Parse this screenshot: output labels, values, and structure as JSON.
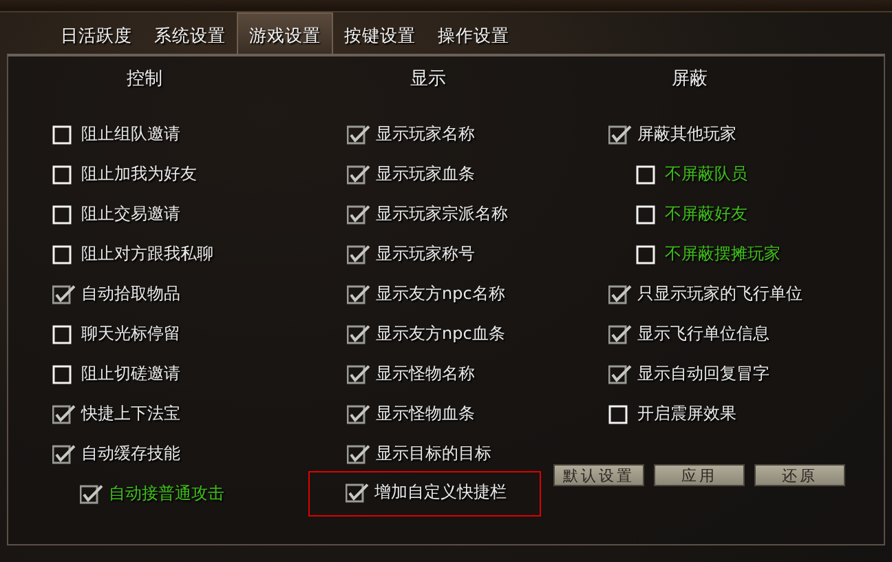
{
  "tabs": [
    {
      "label": "日活跃度",
      "selected": false
    },
    {
      "label": "系统设置",
      "selected": false
    },
    {
      "label": "游戏设置",
      "selected": true
    },
    {
      "label": "按键设置",
      "selected": false
    },
    {
      "label": "操作设置",
      "selected": false
    }
  ],
  "columns": [
    {
      "heading": "控制",
      "options": [
        {
          "label": "阻止组队邀请",
          "checked": false,
          "highlighted": false,
          "outlined": false
        },
        {
          "label": "阻止加我为好友",
          "checked": false,
          "highlighted": false,
          "outlined": false
        },
        {
          "label": "阻止交易邀请",
          "checked": false,
          "highlighted": false,
          "outlined": false
        },
        {
          "label": "阻止对方跟我私聊",
          "checked": false,
          "highlighted": false,
          "outlined": false
        },
        {
          "label": "自动拾取物品",
          "checked": true,
          "highlighted": false,
          "outlined": false
        },
        {
          "label": "聊天光标停留",
          "checked": false,
          "highlighted": false,
          "outlined": false
        },
        {
          "label": "阻止切磋邀请",
          "checked": false,
          "highlighted": false,
          "outlined": false
        },
        {
          "label": "快捷上下法宝",
          "checked": true,
          "highlighted": false,
          "outlined": false
        },
        {
          "label": "自动缓存技能",
          "checked": true,
          "highlighted": false,
          "outlined": false,
          "children": [
            {
              "label": "自动接普通攻击",
              "checked": true,
              "highlighted": true,
              "outlined": false
            }
          ]
        }
      ]
    },
    {
      "heading": "显示",
      "options": [
        {
          "label": "显示玩家名称",
          "checked": true,
          "highlighted": false,
          "outlined": false
        },
        {
          "label": "显示玩家血条",
          "checked": true,
          "highlighted": false,
          "outlined": false
        },
        {
          "label": "显示玩家宗派名称",
          "checked": true,
          "highlighted": false,
          "outlined": false
        },
        {
          "label": "显示玩家称号",
          "checked": true,
          "highlighted": false,
          "outlined": false
        },
        {
          "label": "显示友方npc名称",
          "checked": true,
          "highlighted": false,
          "outlined": false
        },
        {
          "label": "显示友方npc血条",
          "checked": true,
          "highlighted": false,
          "outlined": false
        },
        {
          "label": "显示怪物名称",
          "checked": true,
          "highlighted": false,
          "outlined": false
        },
        {
          "label": "显示怪物血条",
          "checked": true,
          "highlighted": false,
          "outlined": false
        },
        {
          "label": "显示目标的目标",
          "checked": true,
          "highlighted": false,
          "outlined": false
        },
        {
          "label": "增加自定义快捷栏",
          "checked": true,
          "highlighted": false,
          "outlined": true
        }
      ]
    },
    {
      "heading": "屏蔽",
      "options": [
        {
          "label": "屏蔽其他玩家",
          "checked": true,
          "highlighted": false,
          "outlined": false,
          "children": [
            {
              "label": "不屏蔽队员",
              "checked": false,
              "highlighted": true,
              "outlined": false
            },
            {
              "label": "不屏蔽好友",
              "checked": false,
              "highlighted": true,
              "outlined": false
            },
            {
              "label": "不屏蔽摆摊玩家",
              "checked": false,
              "highlighted": true,
              "outlined": false
            }
          ]
        },
        {
          "label": "只显示玩家的飞行单位",
          "checked": true,
          "highlighted": false,
          "outlined": false
        },
        {
          "label": "显示飞行单位信息",
          "checked": true,
          "highlighted": false,
          "outlined": false
        },
        {
          "label": "显示自动回复冒字",
          "checked": true,
          "highlighted": false,
          "outlined": false
        },
        {
          "label": "开启震屏效果",
          "checked": false,
          "highlighted": false,
          "outlined": false
        }
      ]
    }
  ],
  "buttons": [
    "默认设置",
    "应用",
    "还原"
  ]
}
